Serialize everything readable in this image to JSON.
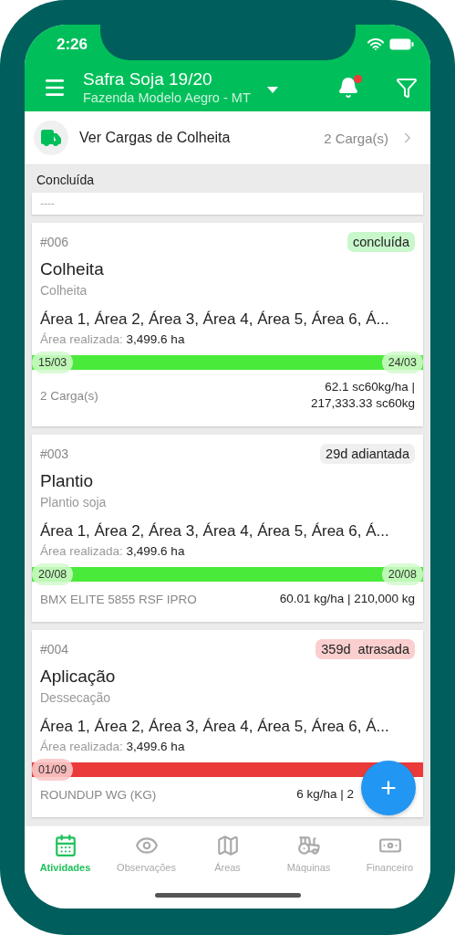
{
  "status_bar": {
    "time": "2:26"
  },
  "header": {
    "title": "Safra Soja 19/20",
    "subtitle": "Fazenda Modelo Aegro - MT",
    "notification": true
  },
  "loads_row": {
    "label": "Ver Cargas de Colheita",
    "count": "2 Carga(s)"
  },
  "section": {
    "title": "Concluída",
    "placeholder_card": "----"
  },
  "cards": [
    {
      "id": "#006",
      "kind": "done",
      "badge": "concluída",
      "title": "Colheita",
      "subtitle": "Colheita",
      "areas": "Área 1, Área 2, Área 3, Área 4, Área 5, Área 6, Á...",
      "realized_label": "Área realizada:",
      "realized_value": "3,499.6 ha",
      "start_date": "15/03",
      "end_date": "24/03",
      "footer_left": "2 Carga(s)",
      "footer_right": [
        "62.1 sc60kg/ha |",
        "217,333.33 sc60kg"
      ]
    },
    {
      "id": "#003",
      "kind": "ahead",
      "badge": "29d adiantada",
      "title": "Plantio",
      "subtitle": "Plantio soja",
      "areas": "Área 1, Área 2, Área 3, Área 4, Área 5, Área 6, Á...",
      "realized_label": "Área realizada:",
      "realized_value": "3,499.6 ha",
      "start_date": "20/08",
      "end_date": "20/08",
      "footer_left": "BMX ELITE 5855 RSF IPRO",
      "footer_right": [
        "60.01 kg/ha | 210,000 kg"
      ]
    },
    {
      "id": "#004",
      "kind": "late",
      "badge": "359d  atrasada",
      "title": "Aplicação",
      "subtitle": "Dessecação",
      "areas": "Área 1, Área 2, Área 3, Área 4, Área 5, Área 6, Á...",
      "realized_label": "Área realizada:",
      "realized_value": "3,499.6 ha",
      "start_date": "01/09",
      "footer_left": "ROUNDUP WG (KG)",
      "footer_right": [
        "6 kg/ha | 2"
      ]
    }
  ],
  "fab": {
    "label": "+"
  },
  "nav": [
    {
      "label": "Atividades",
      "selected": true
    },
    {
      "label": "Observações",
      "selected": false
    },
    {
      "label": "Áreas",
      "selected": false
    },
    {
      "label": "Máquinas",
      "selected": false
    },
    {
      "label": "Financeiro",
      "selected": false
    }
  ]
}
